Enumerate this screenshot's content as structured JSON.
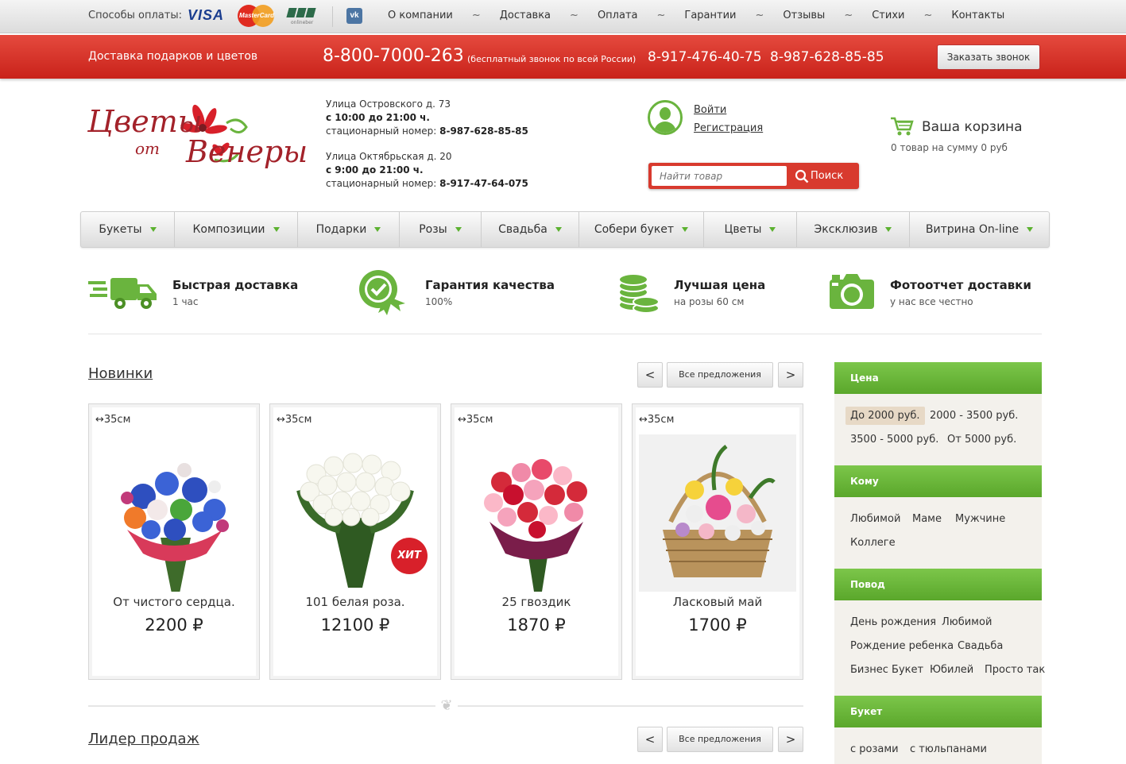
{
  "topbar": {
    "pay_label": "Способы оплаты:",
    "visa": "VISA",
    "mastercard": "MasterCard",
    "onlinebank": "onlineber",
    "vk": "vk",
    "nav": [
      "О компании",
      "Доставка",
      "Оплата",
      "Гарантии",
      "Отзывы",
      "Стихи",
      "Контакты"
    ],
    "separator": "~"
  },
  "redbar": {
    "tagline": "Доставка подарков и цветов",
    "phone_main": "8-800-7000-263",
    "phone_note": "(бесплатный звонок по всей России)",
    "phone2": "8-917-476-40-75",
    "phone3": "8-987-628-85-85",
    "call_button": "Заказать звонок"
  },
  "header": {
    "logo_line1": "Цветы",
    "logo_line2": "от",
    "logo_line3": "Венеры",
    "address1": {
      "street": "Улица Островского д. 73",
      "hours": "с 10:00 до 21:00 ч.",
      "phone_label": "стационарный номер: ",
      "phone": "8-987-628-85-85"
    },
    "address2": {
      "street": "Улица Октябрьская д. 20",
      "hours": "с 9:00 до 21:00 ч.",
      "phone_label": "стационарный номер: ",
      "phone": "8-917-47-64-075"
    },
    "login": "Войти",
    "register": "Регистрация",
    "cart_title": "Ваша корзина",
    "cart_sum": "0 товар на сумму 0 руб",
    "search_placeholder": "Найти товар",
    "search_button": "Поиск"
  },
  "menu": [
    "Букеты",
    "Композиции",
    "Подарки",
    "Розы",
    "Свадьба",
    "Собери букет",
    "Цветы",
    "Эксклюзив",
    "Витрина On-line"
  ],
  "features": [
    {
      "title": "Быстрая доставка",
      "sub": "1 час",
      "icon": "truck-icon"
    },
    {
      "title": "Гарантия качества",
      "sub": "100%",
      "icon": "quality-badge-icon"
    },
    {
      "title": "Лучшая цена",
      "sub": "на розы 60 см",
      "icon": "coins-icon"
    },
    {
      "title": "Фотоотчет доставки",
      "sub": "у нас все честно",
      "icon": "camera-icon"
    }
  ],
  "new_section": {
    "title": "Новинки",
    "prev": "<",
    "next": ">",
    "all": "Все предложения",
    "products": [
      {
        "size": "↔35см",
        "name": "От чистого сердца.",
        "price": "2200 ₽"
      },
      {
        "size": "↔35см",
        "name": "101 белая роза.",
        "price": "12100 ₽",
        "badge": "ХИТ"
      },
      {
        "size": "↔35см",
        "name": "25 гвоздик",
        "price": "1870 ₽"
      },
      {
        "size": "↔35см",
        "name": "Ласковый май",
        "price": "1700 ₽"
      }
    ]
  },
  "leaders_section": {
    "title": "Лидер продаж",
    "prev": "<",
    "next": ">",
    "all": "Все предложения"
  },
  "sidebar": {
    "price": {
      "title": "Цена",
      "items": [
        "До 2000 руб.",
        "2000 - 3500 руб.",
        "3500 - 5000 руб.",
        "От 5000 руб."
      ]
    },
    "whom": {
      "title": "Кому",
      "items": [
        "Любимой",
        "Маме",
        "Мужчине",
        "Коллеге"
      ]
    },
    "occasion": {
      "title": "Повод",
      "items": [
        "День рождения",
        "Любимой",
        "Рождение ребенка",
        "Свадьба",
        "Бизнес Букет",
        "Юбилей",
        "Просто так"
      ]
    },
    "bouquet": {
      "title": "Букет",
      "items": [
        "с розами",
        "с тюльпанами"
      ]
    }
  },
  "colors": {
    "red": "#d83a2e",
    "green": "#6ab43e",
    "logo": "#a3222a"
  }
}
